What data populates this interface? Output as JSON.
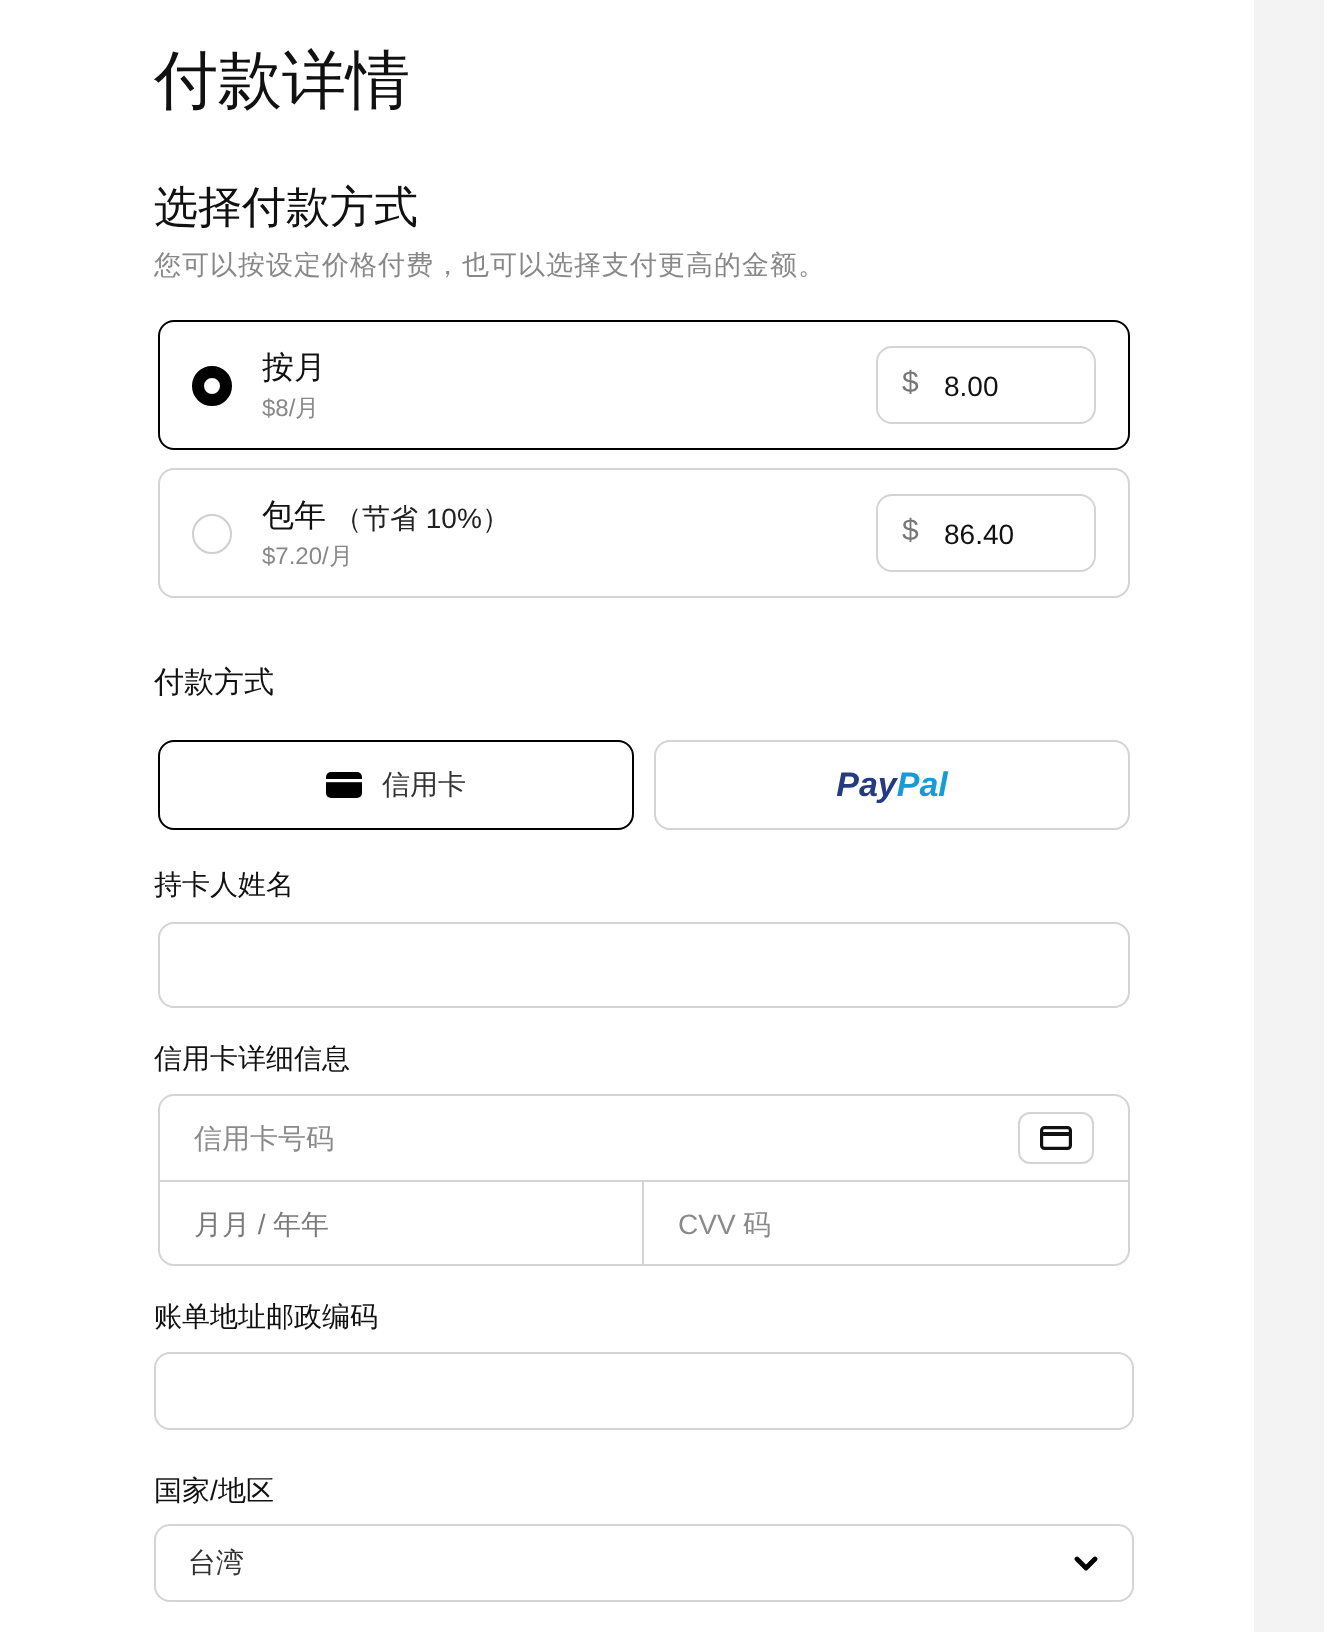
{
  "title": "付款详情",
  "pricing": {
    "heading": "选择付款方式",
    "description": "您可以按设定价格付费，也可以选择支付更高的金额。",
    "options": [
      {
        "label": "按月",
        "price_note": "$8/月",
        "currency": "$",
        "amount": "8.00",
        "selected": true
      },
      {
        "label": "包年",
        "discount": "（节省 10%）",
        "price_note": "$7.20/月",
        "currency": "$",
        "amount": "86.40",
        "selected": false
      }
    ]
  },
  "payment": {
    "heading": "付款方式",
    "methods": [
      {
        "kind": "card",
        "label": "信用卡",
        "selected": true
      },
      {
        "kind": "paypal",
        "logo_parts": [
          "Pay",
          "Pal"
        ],
        "selected": false
      }
    ]
  },
  "cardholder": {
    "label": "持卡人姓名"
  },
  "card_details": {
    "label": "信用卡详细信息",
    "number_placeholder": "信用卡号码",
    "expiry_placeholder": "月月 / 年年",
    "cvv_placeholder": "CVV 码"
  },
  "postal_code": {
    "label": "账单地址邮政编码"
  },
  "country": {
    "label": "国家/地区",
    "value": "台湾"
  }
}
